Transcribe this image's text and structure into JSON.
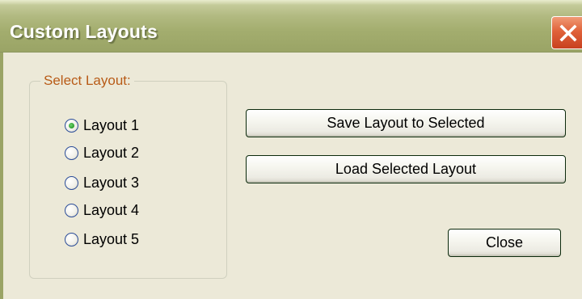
{
  "window": {
    "title": "Custom Layouts",
    "close_icon": "close-icon"
  },
  "colors": {
    "titlebar": "#a3ad6e",
    "close_button": "#e0623a",
    "dialog_bg": "#ece9d8",
    "group_legend": "#b85b17",
    "radio_selected": "#2d9d2d"
  },
  "group": {
    "legend": "Select Layout:",
    "selected_index": 0,
    "options": [
      {
        "label": "Layout 1",
        "checked": true
      },
      {
        "label": "Layout 2",
        "checked": false
      },
      {
        "label": "Layout 3",
        "checked": false
      },
      {
        "label": "Layout 4",
        "checked": false
      },
      {
        "label": "Layout 5",
        "checked": false
      }
    ]
  },
  "buttons": {
    "save": "Save Layout to Selected",
    "load": "Load Selected Layout",
    "close": "Close"
  }
}
